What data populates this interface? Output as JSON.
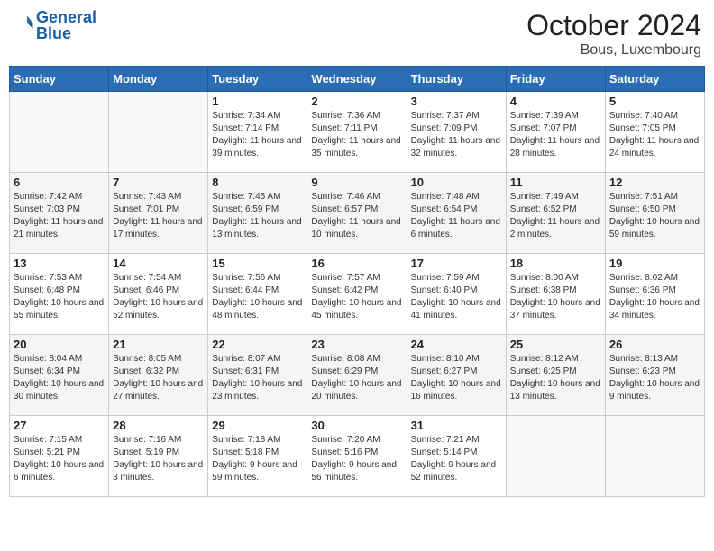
{
  "header": {
    "logo_line1": "General",
    "logo_line2": "Blue",
    "month": "October 2024",
    "location": "Bous, Luxembourg"
  },
  "days_of_week": [
    "Sunday",
    "Monday",
    "Tuesday",
    "Wednesday",
    "Thursday",
    "Friday",
    "Saturday"
  ],
  "weeks": [
    [
      {
        "day": "",
        "info": ""
      },
      {
        "day": "",
        "info": ""
      },
      {
        "day": "1",
        "info": "Sunrise: 7:34 AM\nSunset: 7:14 PM\nDaylight: 11 hours and 39 minutes."
      },
      {
        "day": "2",
        "info": "Sunrise: 7:36 AM\nSunset: 7:11 PM\nDaylight: 11 hours and 35 minutes."
      },
      {
        "day": "3",
        "info": "Sunrise: 7:37 AM\nSunset: 7:09 PM\nDaylight: 11 hours and 32 minutes."
      },
      {
        "day": "4",
        "info": "Sunrise: 7:39 AM\nSunset: 7:07 PM\nDaylight: 11 hours and 28 minutes."
      },
      {
        "day": "5",
        "info": "Sunrise: 7:40 AM\nSunset: 7:05 PM\nDaylight: 11 hours and 24 minutes."
      }
    ],
    [
      {
        "day": "6",
        "info": "Sunrise: 7:42 AM\nSunset: 7:03 PM\nDaylight: 11 hours and 21 minutes."
      },
      {
        "day": "7",
        "info": "Sunrise: 7:43 AM\nSunset: 7:01 PM\nDaylight: 11 hours and 17 minutes."
      },
      {
        "day": "8",
        "info": "Sunrise: 7:45 AM\nSunset: 6:59 PM\nDaylight: 11 hours and 13 minutes."
      },
      {
        "day": "9",
        "info": "Sunrise: 7:46 AM\nSunset: 6:57 PM\nDaylight: 11 hours and 10 minutes."
      },
      {
        "day": "10",
        "info": "Sunrise: 7:48 AM\nSunset: 6:54 PM\nDaylight: 11 hours and 6 minutes."
      },
      {
        "day": "11",
        "info": "Sunrise: 7:49 AM\nSunset: 6:52 PM\nDaylight: 11 hours and 2 minutes."
      },
      {
        "day": "12",
        "info": "Sunrise: 7:51 AM\nSunset: 6:50 PM\nDaylight: 10 hours and 59 minutes."
      }
    ],
    [
      {
        "day": "13",
        "info": "Sunrise: 7:53 AM\nSunset: 6:48 PM\nDaylight: 10 hours and 55 minutes."
      },
      {
        "day": "14",
        "info": "Sunrise: 7:54 AM\nSunset: 6:46 PM\nDaylight: 10 hours and 52 minutes."
      },
      {
        "day": "15",
        "info": "Sunrise: 7:56 AM\nSunset: 6:44 PM\nDaylight: 10 hours and 48 minutes."
      },
      {
        "day": "16",
        "info": "Sunrise: 7:57 AM\nSunset: 6:42 PM\nDaylight: 10 hours and 45 minutes."
      },
      {
        "day": "17",
        "info": "Sunrise: 7:59 AM\nSunset: 6:40 PM\nDaylight: 10 hours and 41 minutes."
      },
      {
        "day": "18",
        "info": "Sunrise: 8:00 AM\nSunset: 6:38 PM\nDaylight: 10 hours and 37 minutes."
      },
      {
        "day": "19",
        "info": "Sunrise: 8:02 AM\nSunset: 6:36 PM\nDaylight: 10 hours and 34 minutes."
      }
    ],
    [
      {
        "day": "20",
        "info": "Sunrise: 8:04 AM\nSunset: 6:34 PM\nDaylight: 10 hours and 30 minutes."
      },
      {
        "day": "21",
        "info": "Sunrise: 8:05 AM\nSunset: 6:32 PM\nDaylight: 10 hours and 27 minutes."
      },
      {
        "day": "22",
        "info": "Sunrise: 8:07 AM\nSunset: 6:31 PM\nDaylight: 10 hours and 23 minutes."
      },
      {
        "day": "23",
        "info": "Sunrise: 8:08 AM\nSunset: 6:29 PM\nDaylight: 10 hours and 20 minutes."
      },
      {
        "day": "24",
        "info": "Sunrise: 8:10 AM\nSunset: 6:27 PM\nDaylight: 10 hours and 16 minutes."
      },
      {
        "day": "25",
        "info": "Sunrise: 8:12 AM\nSunset: 6:25 PM\nDaylight: 10 hours and 13 minutes."
      },
      {
        "day": "26",
        "info": "Sunrise: 8:13 AM\nSunset: 6:23 PM\nDaylight: 10 hours and 9 minutes."
      }
    ],
    [
      {
        "day": "27",
        "info": "Sunrise: 7:15 AM\nSunset: 5:21 PM\nDaylight: 10 hours and 6 minutes."
      },
      {
        "day": "28",
        "info": "Sunrise: 7:16 AM\nSunset: 5:19 PM\nDaylight: 10 hours and 3 minutes."
      },
      {
        "day": "29",
        "info": "Sunrise: 7:18 AM\nSunset: 5:18 PM\nDaylight: 9 hours and 59 minutes."
      },
      {
        "day": "30",
        "info": "Sunrise: 7:20 AM\nSunset: 5:16 PM\nDaylight: 9 hours and 56 minutes."
      },
      {
        "day": "31",
        "info": "Sunrise: 7:21 AM\nSunset: 5:14 PM\nDaylight: 9 hours and 52 minutes."
      },
      {
        "day": "",
        "info": ""
      },
      {
        "day": "",
        "info": ""
      }
    ]
  ]
}
